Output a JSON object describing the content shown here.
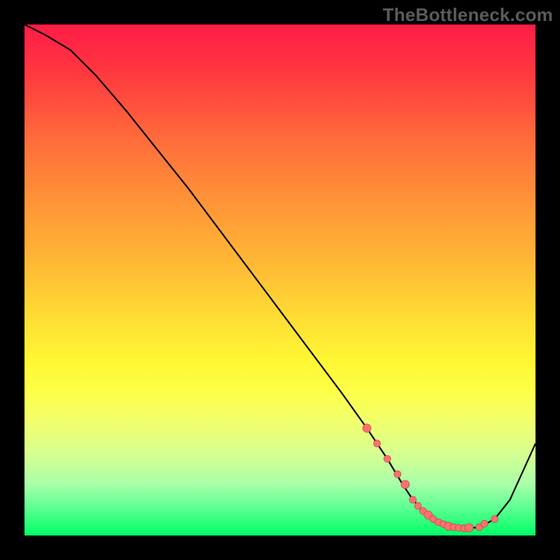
{
  "watermark": "TheBottleneck.com",
  "chart_data": {
    "type": "line",
    "title": "",
    "xlabel": "",
    "ylabel": "",
    "xlim": [
      0,
      100
    ],
    "ylim": [
      0,
      100
    ],
    "series": [
      {
        "name": "curve",
        "x": [
          0,
          4,
          9,
          14,
          20,
          26,
          32,
          38,
          44,
          50,
          56,
          62,
          67,
          71,
          74,
          76,
          78,
          80,
          82,
          84,
          86,
          89,
          92,
          95,
          100
        ],
        "y": [
          100,
          98,
          95,
          90,
          83,
          75.5,
          68,
          60,
          52,
          44,
          36,
          28,
          21,
          15,
          10,
          7,
          4.8,
          3.2,
          2.2,
          1.6,
          1.4,
          1.6,
          3.2,
          7,
          18
        ]
      }
    ],
    "markers": {
      "x": [
        67,
        69,
        71,
        73,
        74.5,
        76,
        77,
        78,
        79,
        80,
        81,
        82,
        83,
        84,
        85,
        86,
        87,
        89,
        90,
        92
      ],
      "y": [
        21,
        18,
        15,
        12,
        10,
        7,
        5.8,
        4.8,
        4.0,
        3.2,
        2.6,
        2.2,
        1.8,
        1.6,
        1.5,
        1.4,
        1.5,
        1.6,
        2.3,
        3.2
      ]
    },
    "background_gradient": {
      "top": "#ff1b47",
      "mid": "#fff733",
      "bottom": "#00ff66"
    }
  }
}
